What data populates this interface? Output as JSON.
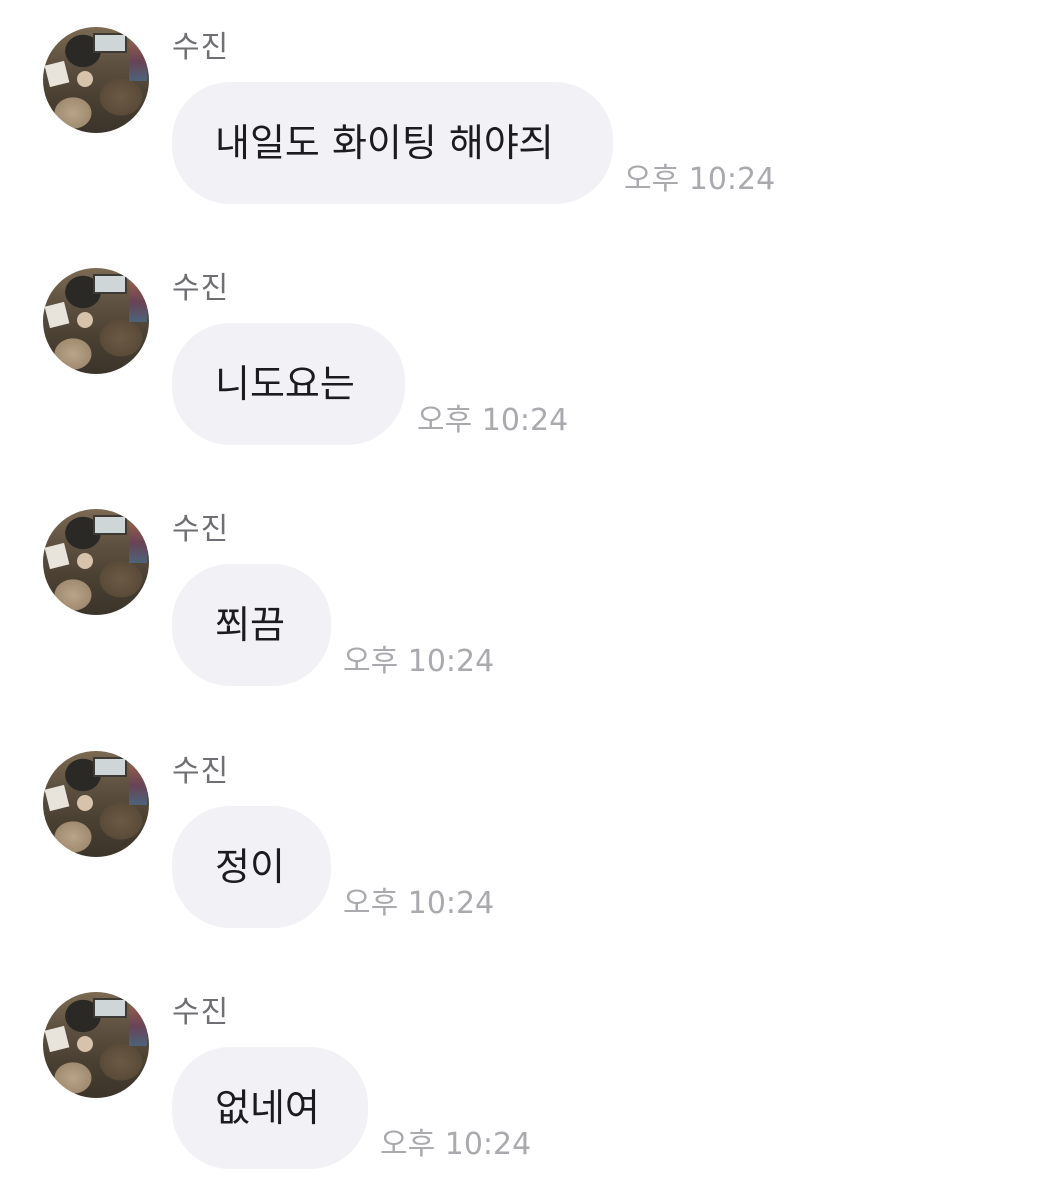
{
  "messages": [
    {
      "sender": "수진",
      "text": "내일도 화이팅 해야즤",
      "time": "오후 10:24"
    },
    {
      "sender": "수진",
      "text": "니도요는",
      "time": "오후 10:24"
    },
    {
      "sender": "수진",
      "text": "쬐끔",
      "time": "오후 10:24"
    },
    {
      "sender": "수진",
      "text": "정이",
      "time": "오후 10:24"
    },
    {
      "sender": "수진",
      "text": "없네여",
      "time": "오후 10:24"
    }
  ],
  "colors": {
    "bubble": "#f2f2f6",
    "sender_text": "#6e6e73",
    "message_text": "#1c1c1e",
    "timestamp_text": "#a9a9ae"
  },
  "icons": {
    "avatar": "profile-photo"
  }
}
